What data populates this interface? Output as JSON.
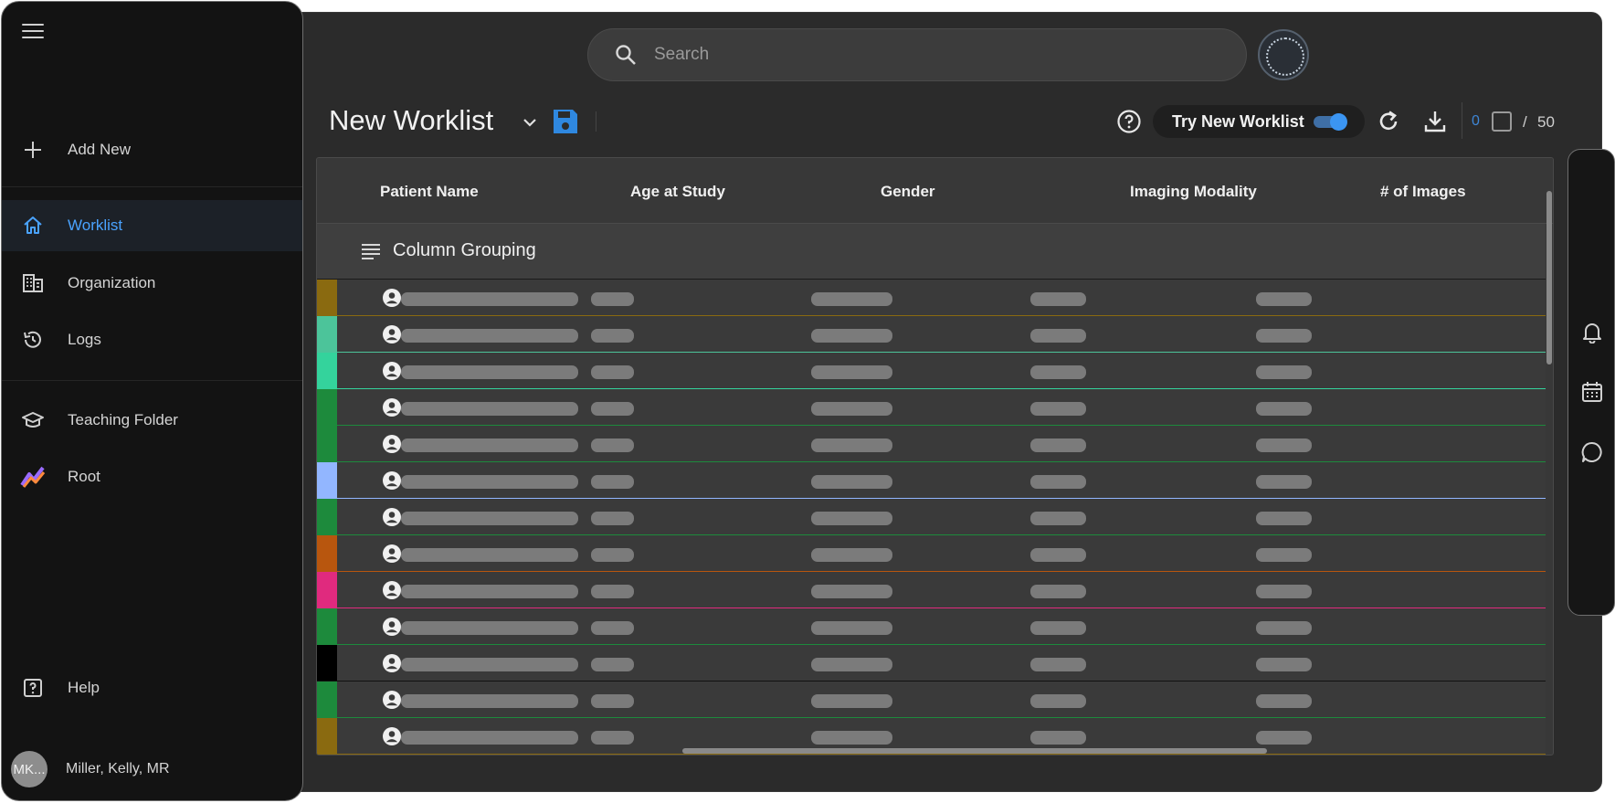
{
  "sidebar": {
    "menu_icon": "hamburger-icon",
    "items": [
      {
        "label": "Add New",
        "icon": "plus-icon"
      },
      {
        "label": "Worklist",
        "icon": "home-icon",
        "active": true
      },
      {
        "label": "Organization",
        "icon": "organization-icon"
      },
      {
        "label": "Logs",
        "icon": "history-icon"
      },
      {
        "label": "Teaching Folder",
        "icon": "graduation-cap-icon"
      },
      {
        "label": "Root",
        "icon": "root-logo-icon"
      },
      {
        "label": "Help",
        "icon": "help-box-icon"
      }
    ],
    "user": {
      "initials": "MK...",
      "name": "Miller, Kelly, MR"
    }
  },
  "search": {
    "placeholder": "Search"
  },
  "header": {
    "title": "New Worklist",
    "try_new_worklist": "Try New Worklist",
    "toggle_on": true,
    "selected_count": "0",
    "slash": "/",
    "total_count": "50"
  },
  "table": {
    "columns": [
      "Patient Name",
      "Age at Study",
      "Gender",
      "Imaging Modality",
      "# of Images"
    ],
    "grouping_label": "Column Grouping",
    "row_colors": [
      "#8a6a10",
      "#4cc49a",
      "#34d39c",
      "#1d8a3c",
      "#1d8a3c",
      "#92b6ff",
      "#1d8a3c",
      "#b8560e",
      "#e02a7e",
      "#1d8a3c",
      "#000000",
      "#1d8a3c",
      "#8a6a10"
    ]
  },
  "colors": {
    "accent": "#4aa3ff",
    "save": "#2f88e0",
    "panel": "#2b2b2b",
    "sidebar": "#131313"
  },
  "right_rail": {
    "icons": [
      "bell-icon",
      "calendar-icon",
      "chat-icon"
    ]
  }
}
